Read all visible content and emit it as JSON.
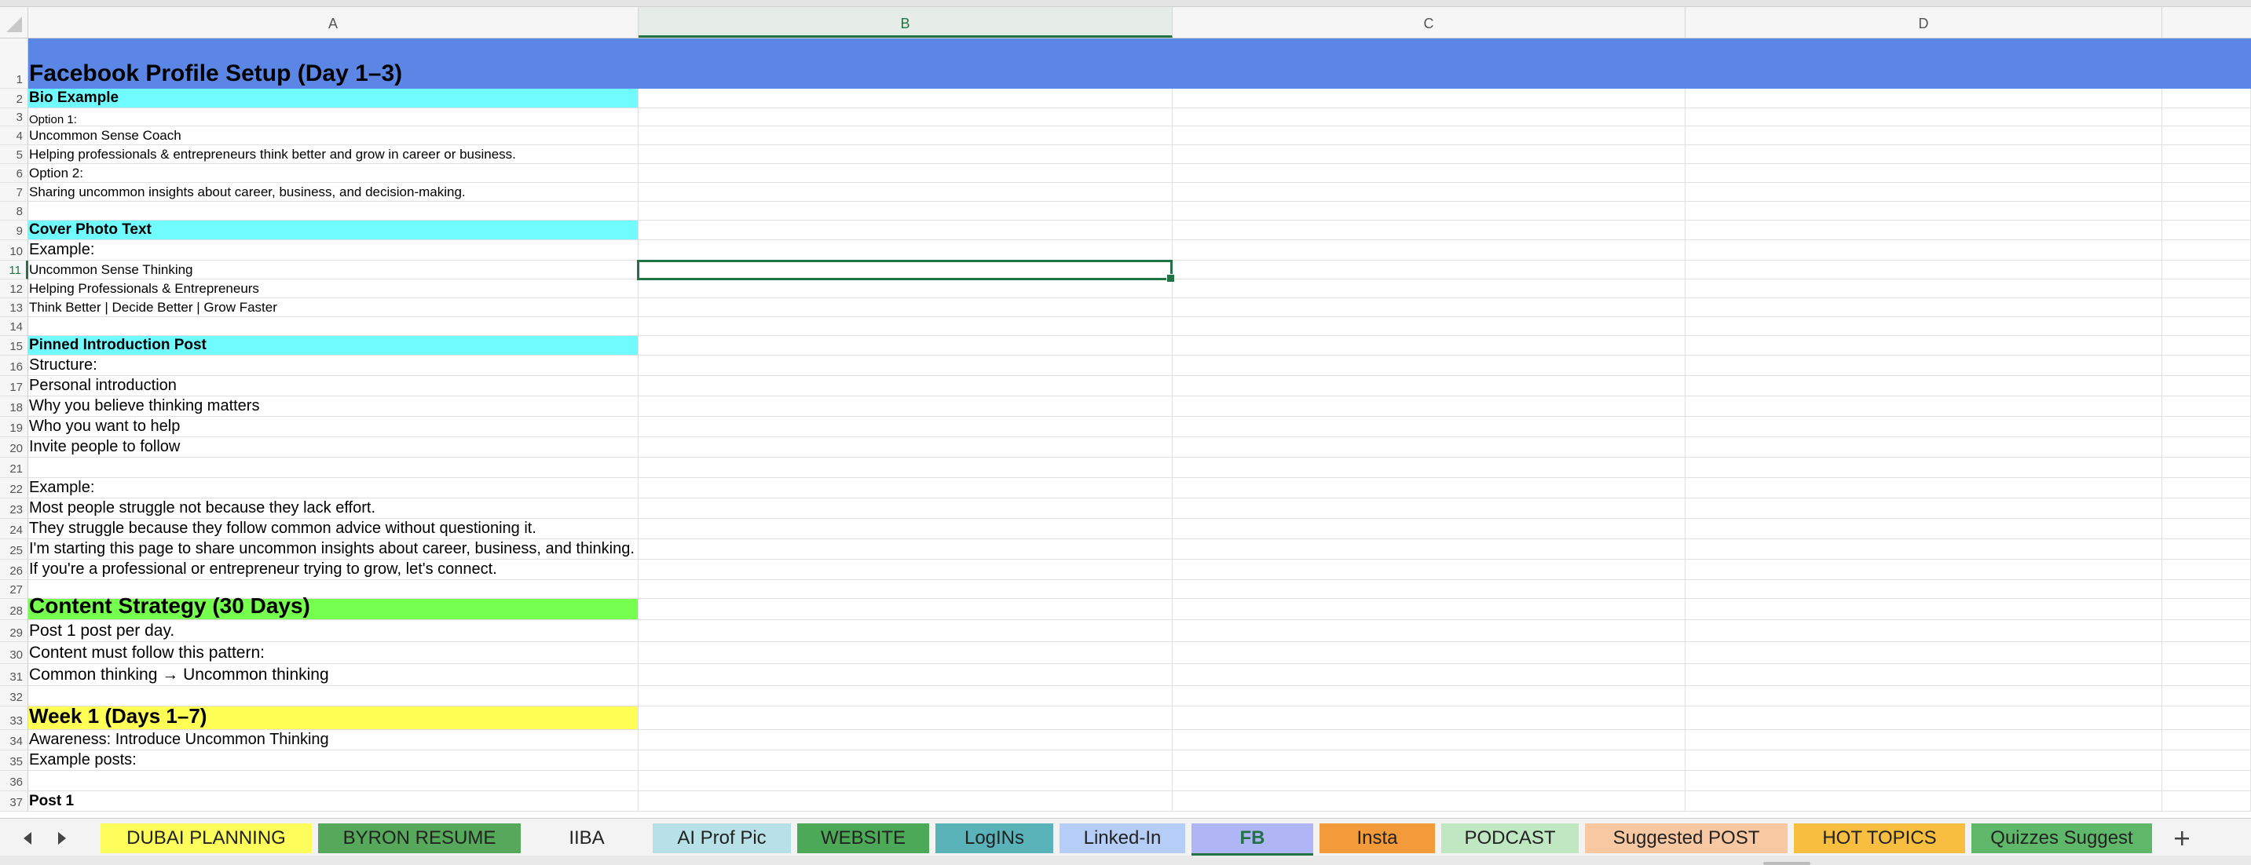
{
  "columns": [
    {
      "label": "A",
      "selected": false
    },
    {
      "label": "B",
      "selected": true
    },
    {
      "label": "C",
      "selected": false
    },
    {
      "label": "D",
      "selected": false
    }
  ],
  "rows": [
    {
      "num": "1",
      "text": "Facebook Profile Setup (Day 1–3)",
      "style": "title",
      "fill": "#5b86e5"
    },
    {
      "num": "2",
      "text": "Bio Example",
      "style": "heading",
      "fill": "#6ffbff"
    },
    {
      "num": "3",
      "text": "Option 1:",
      "style": "tiny",
      "fill": ""
    },
    {
      "num": "4",
      "text": "Uncommon Sense Coach",
      "style": "small",
      "fill": ""
    },
    {
      "num": "5",
      "text": "Helping professionals & entrepreneurs think better and grow in career or business.",
      "style": "small",
      "fill": ""
    },
    {
      "num": "6",
      "text": "Option 2:",
      "style": "small",
      "fill": ""
    },
    {
      "num": "7",
      "text": "Sharing uncommon insights about career, business, and decision-making.",
      "style": "small",
      "fill": ""
    },
    {
      "num": "8",
      "text": "",
      "style": "small",
      "fill": ""
    },
    {
      "num": "9",
      "text": "Cover Photo Text",
      "style": "heading",
      "fill": "#6ffbff"
    },
    {
      "num": "10",
      "text": "Example:",
      "style": "normal",
      "fill": ""
    },
    {
      "num": "11",
      "text": "Uncommon Sense Thinking",
      "style": "small",
      "fill": ""
    },
    {
      "num": "12",
      "text": "Helping Professionals & Entrepreneurs",
      "style": "small",
      "fill": ""
    },
    {
      "num": "13",
      "text": "Think Better | Decide Better | Grow Faster",
      "style": "small",
      "fill": ""
    },
    {
      "num": "14",
      "text": "",
      "style": "small",
      "fill": ""
    },
    {
      "num": "15",
      "text": "Pinned Introduction Post",
      "style": "heading",
      "fill": "#6ffbff"
    },
    {
      "num": "16",
      "text": "Structure:",
      "style": "normal",
      "fill": ""
    },
    {
      "num": "17",
      "text": "Personal introduction",
      "style": "normal",
      "fill": ""
    },
    {
      "num": "18",
      "text": "Why you believe thinking matters",
      "style": "normal",
      "fill": ""
    },
    {
      "num": "19",
      "text": "Who you want to help",
      "style": "normal",
      "fill": ""
    },
    {
      "num": "20",
      "text": "Invite people to follow",
      "style": "normal",
      "fill": ""
    },
    {
      "num": "21",
      "text": "",
      "style": "normal",
      "fill": ""
    },
    {
      "num": "22",
      "text": "Example:",
      "style": "normal",
      "fill": ""
    },
    {
      "num": "23",
      "text": "Most people struggle not because they lack effort.",
      "style": "normal",
      "fill": ""
    },
    {
      "num": "24",
      "text": "They struggle because they follow common advice without questioning it.",
      "style": "normal",
      "fill": ""
    },
    {
      "num": "25",
      "text": "I'm starting this page to share uncommon insights about career, business, and thinking.",
      "style": "normal",
      "fill": ""
    },
    {
      "num": "26",
      "text": "If you're a professional or entrepreneur trying to grow, let's connect.",
      "style": "normal",
      "fill": ""
    },
    {
      "num": "27",
      "text": "",
      "style": "small",
      "fill": ""
    },
    {
      "num": "28",
      "text": "Content Strategy (30 Days)",
      "style": "title2",
      "fill": "#77ff4f"
    },
    {
      "num": "29",
      "text": "Post 1 post per day.",
      "style": "normal2",
      "fill": ""
    },
    {
      "num": "30",
      "text": "Content must follow this pattern:",
      "style": "normal2",
      "fill": ""
    },
    {
      "num": "31",
      "text": "Common thinking → Uncommon thinking",
      "style": "normal2",
      "fill": ""
    },
    {
      "num": "32",
      "text": "",
      "style": "normal",
      "fill": ""
    },
    {
      "num": "33",
      "text": "Week 1 (Days 1–7)",
      "style": "title3",
      "fill": "#ffff55"
    },
    {
      "num": "34",
      "text": "Awareness: Introduce Uncommon Thinking",
      "style": "normal",
      "fill": ""
    },
    {
      "num": "35",
      "text": "Example posts:",
      "style": "normal",
      "fill": ""
    },
    {
      "num": "36",
      "text": "",
      "style": "normal",
      "fill": ""
    },
    {
      "num": "37",
      "text": "Post 1",
      "style": "boldnormal",
      "fill": ""
    }
  ],
  "selected_cell": {
    "row": "11",
    "col": "B"
  },
  "sheet_tabs": [
    {
      "label": "DUBAI PLANNING",
      "color": "#fdfd5c",
      "active": false
    },
    {
      "label": "BYRON RESUME",
      "color": "#56a85a",
      "active": false
    },
    {
      "label": "IIBA",
      "color": "#f3f3f3",
      "active": false
    },
    {
      "label": "AI Prof Pic",
      "color": "#b7e1e6",
      "active": false
    },
    {
      "label": "WEBSITE",
      "color": "#4ca957",
      "active": false
    },
    {
      "label": "LogINs",
      "color": "#5ab3b8",
      "active": false
    },
    {
      "label": "Linked-In",
      "color": "#b6cdf7",
      "active": false
    },
    {
      "label": "FB",
      "color": "#b0b6f5",
      "active": true
    },
    {
      "label": "Insta",
      "color": "#f39a3b",
      "active": false
    },
    {
      "label": "PODCAST",
      "color": "#bfe7c2",
      "active": false
    },
    {
      "label": "Suggested POST",
      "color": "#f8c8a3",
      "active": false
    },
    {
      "label": "HOT TOPICS",
      "color": "#f7be3f",
      "active": false
    },
    {
      "label": "Quizzes Suggest",
      "color": "#5fb86a",
      "active": false
    }
  ],
  "icons": {
    "prev": "chevron-left-icon",
    "next": "chevron-right-icon",
    "add": "plus-icon"
  }
}
